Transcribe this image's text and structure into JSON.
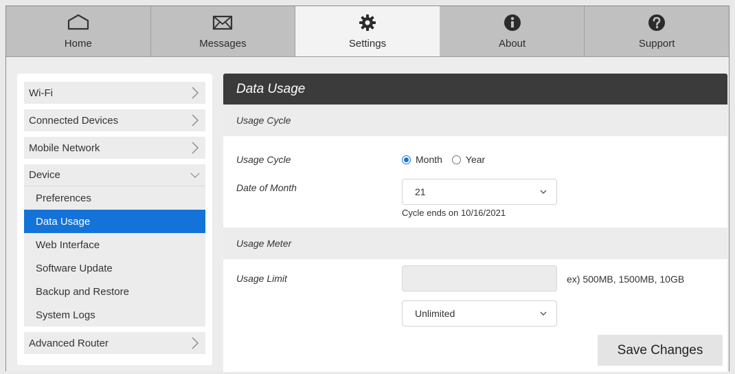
{
  "nav": {
    "tabs": [
      {
        "label": "Home",
        "icon": "home-icon"
      },
      {
        "label": "Messages",
        "icon": "envelope-icon"
      },
      {
        "label": "Settings",
        "icon": "gear-icon",
        "active": true
      },
      {
        "label": "About",
        "icon": "info-icon"
      },
      {
        "label": "Support",
        "icon": "question-icon"
      }
    ]
  },
  "sidebar": {
    "wifi": "Wi-Fi",
    "connected_devices": "Connected Devices",
    "mobile_network": "Mobile Network",
    "device": "Device",
    "device_sub": [
      "Preferences",
      "Data Usage",
      "Web Interface",
      "Software Update",
      "Backup and Restore",
      "System Logs"
    ],
    "selected": "Data Usage",
    "advanced_router": "Advanced Router"
  },
  "panel": {
    "title": "Data Usage",
    "usage_cycle_section": "Usage Cycle",
    "usage_cycle_label": "Usage Cycle",
    "option_month": "Month",
    "option_year": "Year",
    "selected_option": "Month",
    "date_of_month_label": "Date of Month",
    "date_of_month_value": "21",
    "cycle_end_text": "Cycle ends on 10/16/2021",
    "usage_meter_section": "Usage Meter",
    "usage_limit_label": "Usage Limit",
    "usage_limit_value": "",
    "usage_limit_example": "ex) 500MB, 1500MB, 10GB",
    "limit_unit_value": "Unlimited",
    "save_label": "Save Changes"
  },
  "colors": {
    "accent": "#1473d8",
    "header_dark": "#3b3b3b",
    "nav_bg": "#c0c0c0"
  }
}
